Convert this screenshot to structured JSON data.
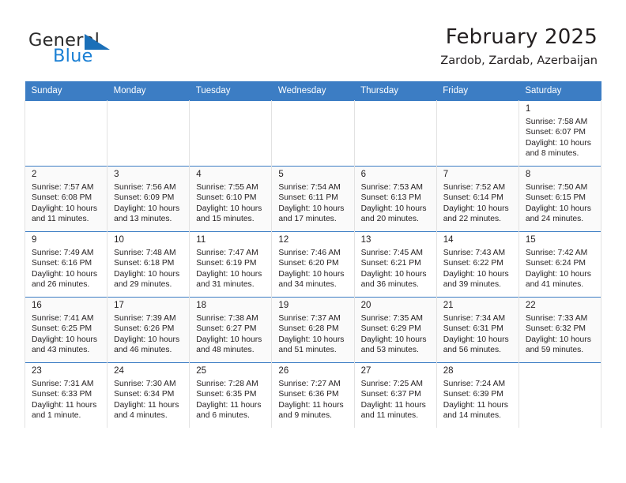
{
  "brand": {
    "name_part1": "General",
    "name_part2": "Blue",
    "flag_icon": "blue-triangle-flag-icon",
    "accent_color": "#1a7fd4"
  },
  "header": {
    "title": "February 2025",
    "location": "Zardob, Zardab, Azerbaijan"
  },
  "calendar": {
    "header_bg_color": "#3c7dc4",
    "weekday_headers": [
      "Sunday",
      "Monday",
      "Tuesday",
      "Wednesday",
      "Thursday",
      "Friday",
      "Saturday"
    ],
    "labels": {
      "sunrise": "Sunrise:",
      "sunset": "Sunset:",
      "daylight": "Daylight:"
    },
    "weeks": [
      [
        {
          "day": "",
          "sunrise": "",
          "sunset": "",
          "daylight_line1": "",
          "daylight_line2": ""
        },
        {
          "day": "",
          "sunrise": "",
          "sunset": "",
          "daylight_line1": "",
          "daylight_line2": ""
        },
        {
          "day": "",
          "sunrise": "",
          "sunset": "",
          "daylight_line1": "",
          "daylight_line2": ""
        },
        {
          "day": "",
          "sunrise": "",
          "sunset": "",
          "daylight_line1": "",
          "daylight_line2": ""
        },
        {
          "day": "",
          "sunrise": "",
          "sunset": "",
          "daylight_line1": "",
          "daylight_line2": ""
        },
        {
          "day": "",
          "sunrise": "",
          "sunset": "",
          "daylight_line1": "",
          "daylight_line2": ""
        },
        {
          "day": "1",
          "sunrise": "Sunrise: 7:58 AM",
          "sunset": "Sunset: 6:07 PM",
          "daylight_line1": "Daylight: 10 hours",
          "daylight_line2": "and 8 minutes."
        }
      ],
      [
        {
          "day": "2",
          "sunrise": "Sunrise: 7:57 AM",
          "sunset": "Sunset: 6:08 PM",
          "daylight_line1": "Daylight: 10 hours",
          "daylight_line2": "and 11 minutes."
        },
        {
          "day": "3",
          "sunrise": "Sunrise: 7:56 AM",
          "sunset": "Sunset: 6:09 PM",
          "daylight_line1": "Daylight: 10 hours",
          "daylight_line2": "and 13 minutes."
        },
        {
          "day": "4",
          "sunrise": "Sunrise: 7:55 AM",
          "sunset": "Sunset: 6:10 PM",
          "daylight_line1": "Daylight: 10 hours",
          "daylight_line2": "and 15 minutes."
        },
        {
          "day": "5",
          "sunrise": "Sunrise: 7:54 AM",
          "sunset": "Sunset: 6:11 PM",
          "daylight_line1": "Daylight: 10 hours",
          "daylight_line2": "and 17 minutes."
        },
        {
          "day": "6",
          "sunrise": "Sunrise: 7:53 AM",
          "sunset": "Sunset: 6:13 PM",
          "daylight_line1": "Daylight: 10 hours",
          "daylight_line2": "and 20 minutes."
        },
        {
          "day": "7",
          "sunrise": "Sunrise: 7:52 AM",
          "sunset": "Sunset: 6:14 PM",
          "daylight_line1": "Daylight: 10 hours",
          "daylight_line2": "and 22 minutes."
        },
        {
          "day": "8",
          "sunrise": "Sunrise: 7:50 AM",
          "sunset": "Sunset: 6:15 PM",
          "daylight_line1": "Daylight: 10 hours",
          "daylight_line2": "and 24 minutes."
        }
      ],
      [
        {
          "day": "9",
          "sunrise": "Sunrise: 7:49 AM",
          "sunset": "Sunset: 6:16 PM",
          "daylight_line1": "Daylight: 10 hours",
          "daylight_line2": "and 26 minutes."
        },
        {
          "day": "10",
          "sunrise": "Sunrise: 7:48 AM",
          "sunset": "Sunset: 6:18 PM",
          "daylight_line1": "Daylight: 10 hours",
          "daylight_line2": "and 29 minutes."
        },
        {
          "day": "11",
          "sunrise": "Sunrise: 7:47 AM",
          "sunset": "Sunset: 6:19 PM",
          "daylight_line1": "Daylight: 10 hours",
          "daylight_line2": "and 31 minutes."
        },
        {
          "day": "12",
          "sunrise": "Sunrise: 7:46 AM",
          "sunset": "Sunset: 6:20 PM",
          "daylight_line1": "Daylight: 10 hours",
          "daylight_line2": "and 34 minutes."
        },
        {
          "day": "13",
          "sunrise": "Sunrise: 7:45 AM",
          "sunset": "Sunset: 6:21 PM",
          "daylight_line1": "Daylight: 10 hours",
          "daylight_line2": "and 36 minutes."
        },
        {
          "day": "14",
          "sunrise": "Sunrise: 7:43 AM",
          "sunset": "Sunset: 6:22 PM",
          "daylight_line1": "Daylight: 10 hours",
          "daylight_line2": "and 39 minutes."
        },
        {
          "day": "15",
          "sunrise": "Sunrise: 7:42 AM",
          "sunset": "Sunset: 6:24 PM",
          "daylight_line1": "Daylight: 10 hours",
          "daylight_line2": "and 41 minutes."
        }
      ],
      [
        {
          "day": "16",
          "sunrise": "Sunrise: 7:41 AM",
          "sunset": "Sunset: 6:25 PM",
          "daylight_line1": "Daylight: 10 hours",
          "daylight_line2": "and 43 minutes."
        },
        {
          "day": "17",
          "sunrise": "Sunrise: 7:39 AM",
          "sunset": "Sunset: 6:26 PM",
          "daylight_line1": "Daylight: 10 hours",
          "daylight_line2": "and 46 minutes."
        },
        {
          "day": "18",
          "sunrise": "Sunrise: 7:38 AM",
          "sunset": "Sunset: 6:27 PM",
          "daylight_line1": "Daylight: 10 hours",
          "daylight_line2": "and 48 minutes."
        },
        {
          "day": "19",
          "sunrise": "Sunrise: 7:37 AM",
          "sunset": "Sunset: 6:28 PM",
          "daylight_line1": "Daylight: 10 hours",
          "daylight_line2": "and 51 minutes."
        },
        {
          "day": "20",
          "sunrise": "Sunrise: 7:35 AM",
          "sunset": "Sunset: 6:29 PM",
          "daylight_line1": "Daylight: 10 hours",
          "daylight_line2": "and 53 minutes."
        },
        {
          "day": "21",
          "sunrise": "Sunrise: 7:34 AM",
          "sunset": "Sunset: 6:31 PM",
          "daylight_line1": "Daylight: 10 hours",
          "daylight_line2": "and 56 minutes."
        },
        {
          "day": "22",
          "sunrise": "Sunrise: 7:33 AM",
          "sunset": "Sunset: 6:32 PM",
          "daylight_line1": "Daylight: 10 hours",
          "daylight_line2": "and 59 minutes."
        }
      ],
      [
        {
          "day": "23",
          "sunrise": "Sunrise: 7:31 AM",
          "sunset": "Sunset: 6:33 PM",
          "daylight_line1": "Daylight: 11 hours",
          "daylight_line2": "and 1 minute."
        },
        {
          "day": "24",
          "sunrise": "Sunrise: 7:30 AM",
          "sunset": "Sunset: 6:34 PM",
          "daylight_line1": "Daylight: 11 hours",
          "daylight_line2": "and 4 minutes."
        },
        {
          "day": "25",
          "sunrise": "Sunrise: 7:28 AM",
          "sunset": "Sunset: 6:35 PM",
          "daylight_line1": "Daylight: 11 hours",
          "daylight_line2": "and 6 minutes."
        },
        {
          "day": "26",
          "sunrise": "Sunrise: 7:27 AM",
          "sunset": "Sunset: 6:36 PM",
          "daylight_line1": "Daylight: 11 hours",
          "daylight_line2": "and 9 minutes."
        },
        {
          "day": "27",
          "sunrise": "Sunrise: 7:25 AM",
          "sunset": "Sunset: 6:37 PM",
          "daylight_line1": "Daylight: 11 hours",
          "daylight_line2": "and 11 minutes."
        },
        {
          "day": "28",
          "sunrise": "Sunrise: 7:24 AM",
          "sunset": "Sunset: 6:39 PM",
          "daylight_line1": "Daylight: 11 hours",
          "daylight_line2": "and 14 minutes."
        },
        {
          "day": "",
          "sunrise": "",
          "sunset": "",
          "daylight_line1": "",
          "daylight_line2": ""
        }
      ]
    ]
  }
}
